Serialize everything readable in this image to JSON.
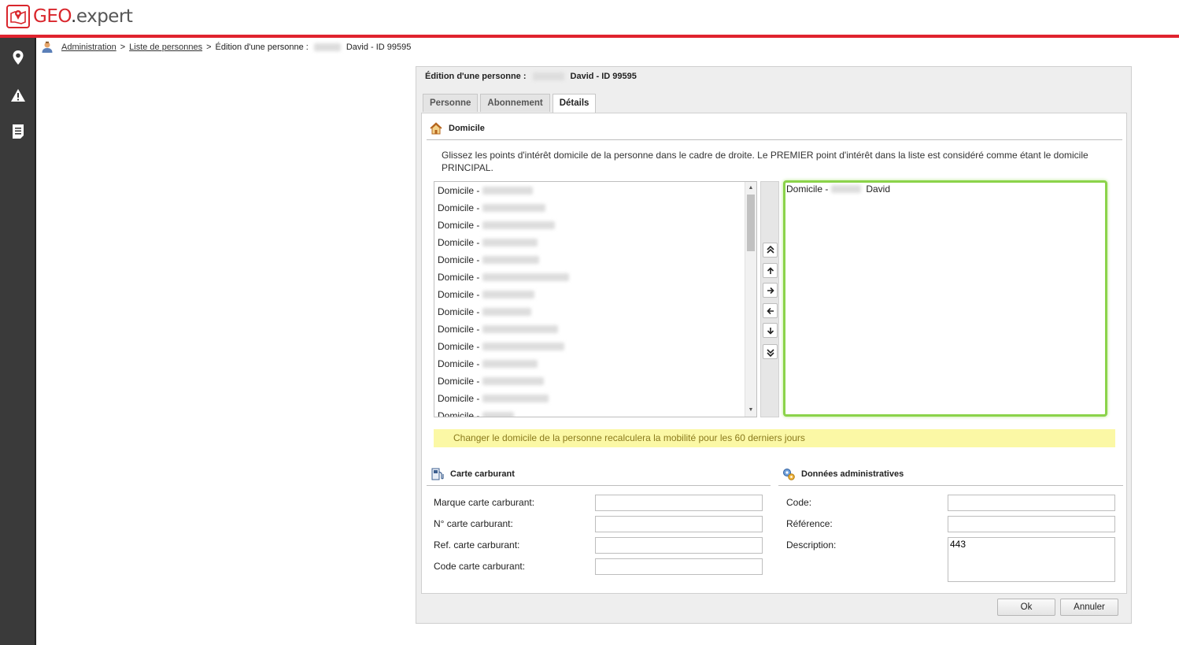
{
  "app": {
    "logo_geo": "GEO",
    "logo_dot": ".",
    "logo_rest": "expert"
  },
  "sidebar": {
    "icons": [
      "map-pin-icon",
      "warning-icon",
      "document-icon"
    ]
  },
  "breadcrumb": {
    "items": [
      "Administration",
      "Liste de personnes"
    ],
    "separator": ">",
    "current_prefix": "Édition d'une personne :",
    "current_suffix": "David - ID 99595"
  },
  "dialog": {
    "title_prefix": "Édition d'une personne :",
    "title_suffix": "David - ID 99595",
    "tabs": [
      {
        "label": "Personne",
        "active": false
      },
      {
        "label": "Abonnement",
        "active": false
      },
      {
        "label": "Détails",
        "active": true
      }
    ],
    "domicile": {
      "heading": "Domicile",
      "description": "Glissez les points d'intérêt domicile de la personne dans le cadre de droite. Le PREMIER point d'intérêt dans la liste est considéré comme étant le domicile PRINCIPAL.",
      "available_items": [
        "Domicile -",
        "Domicile -",
        "Domicile -",
        "Domicile -",
        "Domicile -",
        "Domicile -",
        "Domicile -",
        "Domicile -",
        "Domicile -",
        "Domicile -",
        "Domicile -",
        "Domicile -",
        "Domicile -",
        "Domicile -"
      ],
      "selected_items": [
        {
          "prefix": "Domicile -",
          "name": "David"
        }
      ],
      "move_buttons": [
        "move-top",
        "move-up",
        "move-right",
        "move-left",
        "move-down",
        "move-bottom"
      ],
      "warning": "Changer le domicile de la personne recalculera la mobilité pour les 60 derniers jours"
    },
    "carte": {
      "heading": "Carte carburant",
      "fields": [
        {
          "label": "Marque carte carburant:",
          "value": ""
        },
        {
          "label": "N° carte carburant:",
          "value": ""
        },
        {
          "label": "Ref. carte carburant:",
          "value": ""
        },
        {
          "label": "Code carte carburant:",
          "value": ""
        }
      ]
    },
    "admin": {
      "heading": "Données administratives",
      "fields": [
        {
          "label": "Code:",
          "value": ""
        },
        {
          "label": "Référence:",
          "value": ""
        },
        {
          "label": "Description:",
          "value": "443"
        }
      ]
    },
    "buttons": {
      "ok": "Ok",
      "cancel": "Annuler"
    }
  },
  "colors": {
    "brand_red": "#e0232e",
    "sidebar": "#3a3a3a",
    "target_border": "#8bd34a",
    "warning_bg": "#fbf8a5"
  }
}
